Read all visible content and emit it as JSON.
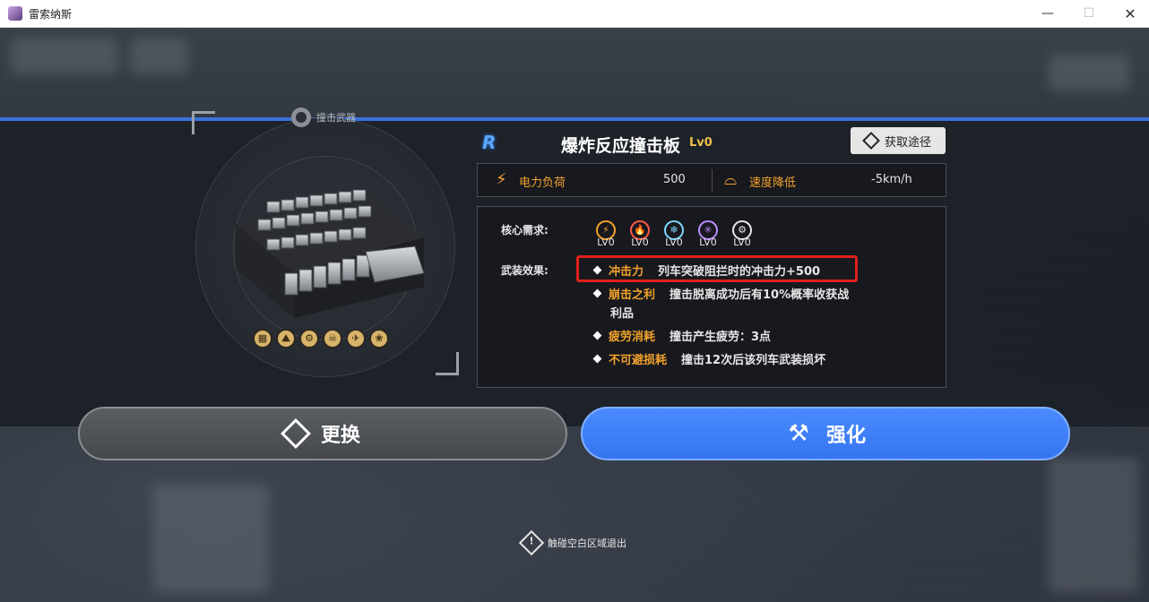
{
  "window": {
    "title": "雷索纳斯",
    "min": "—",
    "max": "☐",
    "close": "✕"
  },
  "weapon": {
    "category": "撞击武器",
    "traits": [
      "▦",
      "⛰",
      "⚙",
      "☠",
      "✈",
      "❀"
    ]
  },
  "item": {
    "rank": "R",
    "name": "爆炸反应撞击板",
    "level": "Lv0",
    "source_button": "获取途径"
  },
  "stats": {
    "power_icon": "⚡",
    "power_label": "电力负荷",
    "power_value": "500",
    "speed_icon": "⌓",
    "speed_label": "速度降低",
    "speed_value": "-5km/h"
  },
  "details": {
    "core_label": "核心需求:",
    "cores": [
      {
        "icon": "⚡",
        "level": "LV0",
        "color": "#f3a22c"
      },
      {
        "icon": "🔥",
        "level": "LV0",
        "color": "#ff5a4a"
      },
      {
        "icon": "❄",
        "level": "LV0",
        "color": "#7fd7ff"
      },
      {
        "icon": "✳",
        "level": "LV0",
        "color": "#b98cff"
      },
      {
        "icon": "⚙",
        "level": "LV0",
        "color": "#e6e6e6"
      }
    ],
    "effect_label": "武装效果:",
    "effects": [
      {
        "name": "冲击力",
        "text": "列车突破阻拦时的冲击力+500"
      },
      {
        "name": "崩击之利",
        "text": "撞击脱离成功后有10%概率收获战"
      },
      {
        "name": "",
        "text": "利品"
      },
      {
        "name": "疲劳消耗",
        "text": "撞击产生疲劳：3点"
      },
      {
        "name": "不可避损耗",
        "text": "撞击12次后该列车武装损坏"
      }
    ]
  },
  "actions": {
    "swap": "更换",
    "upgrade": "强化"
  },
  "hint": {
    "icon": "!",
    "text": "触碰空白区域退出"
  },
  "colors": {
    "accent": "#3a73d9",
    "highlight": "#f3a22c",
    "selection_box": "#e0201c"
  }
}
